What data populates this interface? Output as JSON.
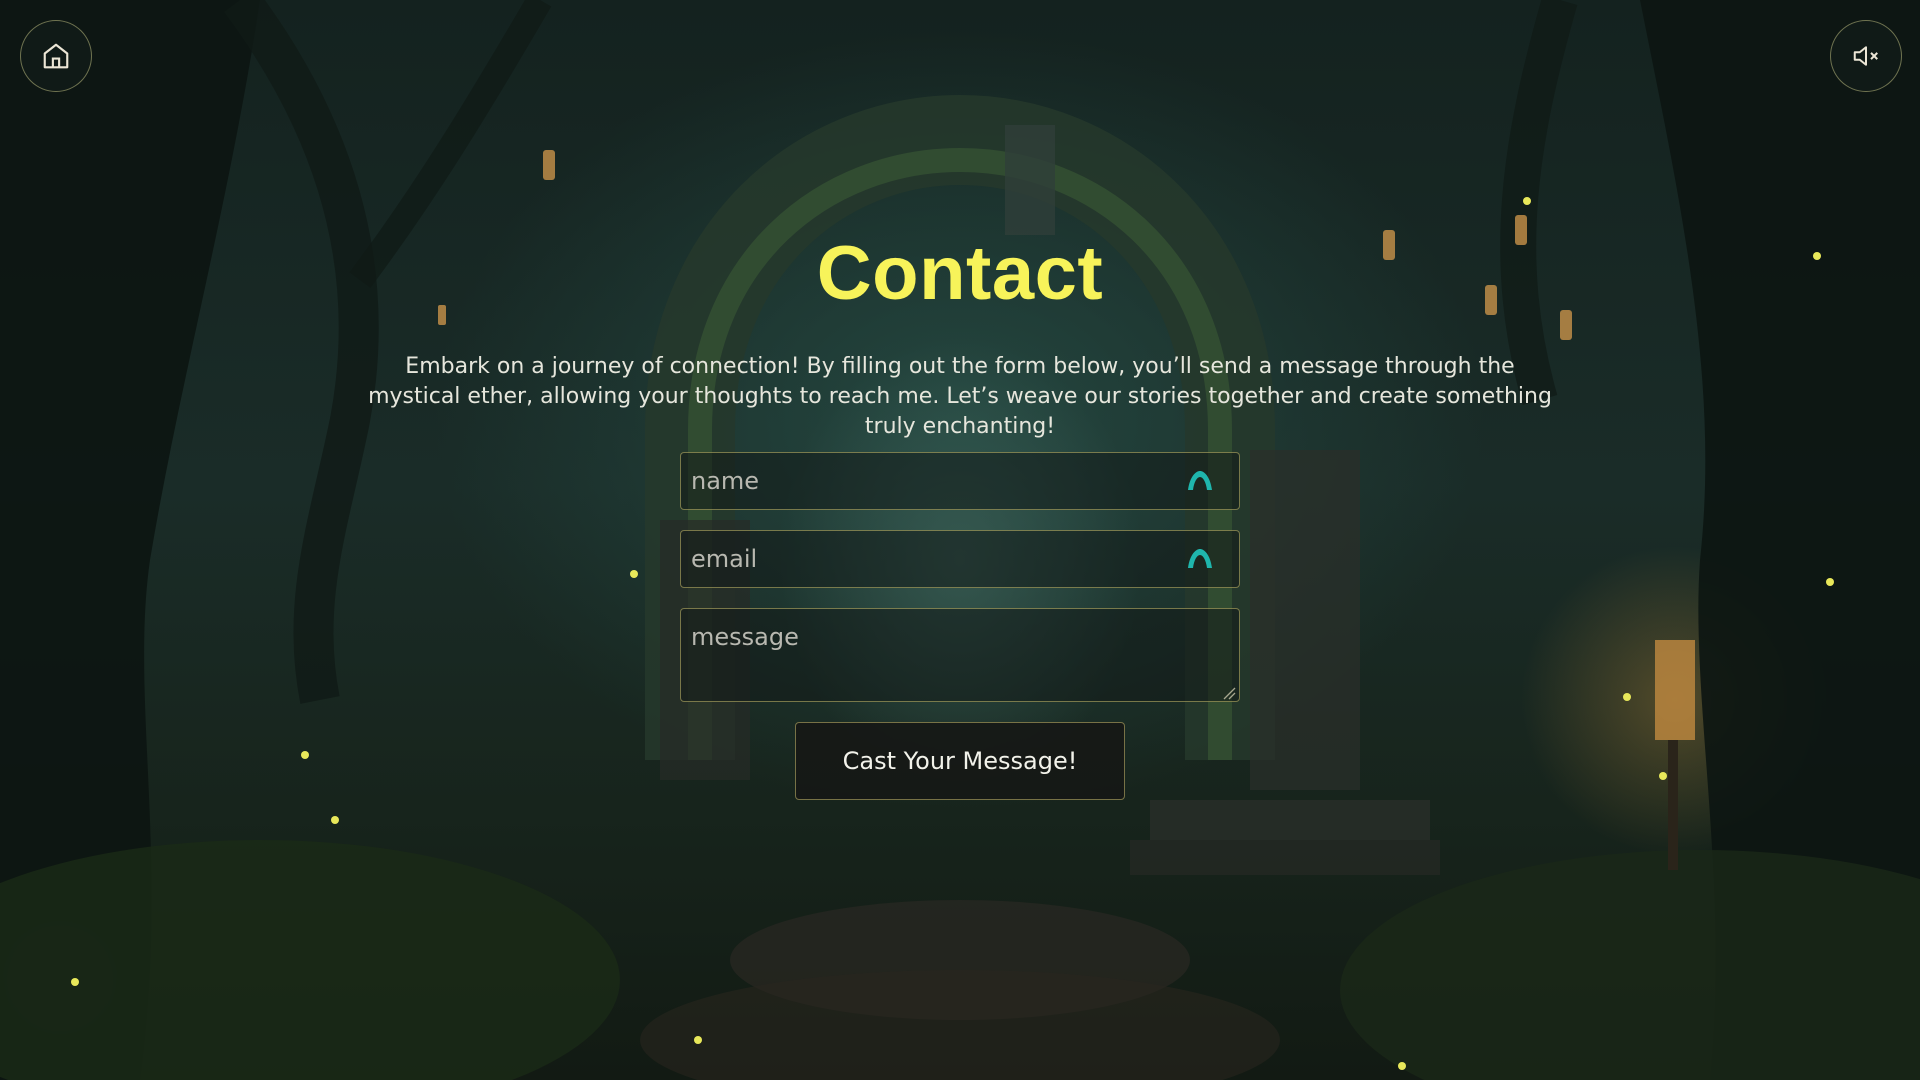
{
  "page": {
    "title": "Contact",
    "intro": "Embark on a journey of connection! By filling out the form below, you’ll send a message through the mystical ether, allowing your thoughts to reach me. Let’s weave our stories together and create something truly enchanting!"
  },
  "nav": {
    "home_icon": "home-icon",
    "mute_icon": "speaker-muted-icon"
  },
  "form": {
    "name_placeholder": "name",
    "email_placeholder": "email",
    "message_placeholder": "message",
    "name_value": "",
    "email_value": "",
    "message_value": "",
    "submit_label": "Cast Your Message!",
    "autofill_icon": "password-manager-icon"
  },
  "colors": {
    "title": "#f7f35a",
    "accent": "#1fb6ad",
    "border": "#c8be6e"
  }
}
